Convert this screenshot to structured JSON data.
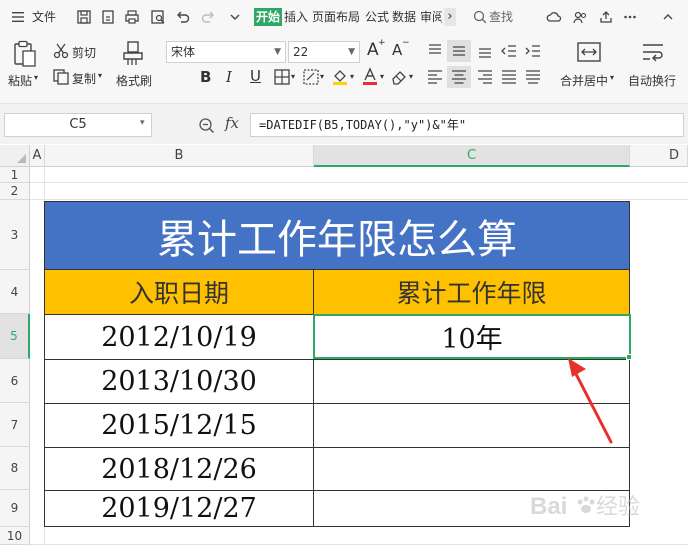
{
  "menu": {
    "file_label": "文件",
    "tabs": [
      "开始",
      "插入",
      "页面布局",
      "公式",
      "数据",
      "审阅"
    ],
    "more_arrow": "›",
    "search_label": "查找"
  },
  "ribbon": {
    "paste_label": "粘贴",
    "cut_label": "剪切",
    "copy_label": "复制",
    "format_painter_label": "格式刷",
    "font_name": "宋体",
    "font_size": "22",
    "grow_font": "A",
    "shrink_font": "A",
    "bold": "B",
    "italic": "I",
    "underline": "U",
    "merge_label": "合并居中",
    "wrap_label": "自动换行"
  },
  "formula_bar": {
    "name_box": "C5",
    "zoom_icon": "search-zoom-icon",
    "fx": "fx",
    "formula": "=DATEDIF(B5,TODAY(),\"y\")&\"年\""
  },
  "columns": [
    "A",
    "B",
    "C",
    "D"
  ],
  "rows": [
    "1",
    "2",
    "3",
    "4",
    "5",
    "6",
    "7",
    "8",
    "9",
    "10"
  ],
  "active_cell": {
    "column": "C",
    "row": "5"
  },
  "table": {
    "title": "累计工作年限怎么算",
    "header_b": "入职日期",
    "header_c": "累计工作年限",
    "dates": [
      "2012/10/19",
      "2013/10/30",
      "2015/12/15",
      "2018/12/26",
      "2019/12/27"
    ],
    "result_c5": "10年"
  },
  "colors": {
    "title_bg": "#4472c4",
    "header_bg": "#ffc000",
    "accent_green": "#2fa865",
    "arrow_red": "#e8302c"
  },
  "watermark": "Baidu经验"
}
